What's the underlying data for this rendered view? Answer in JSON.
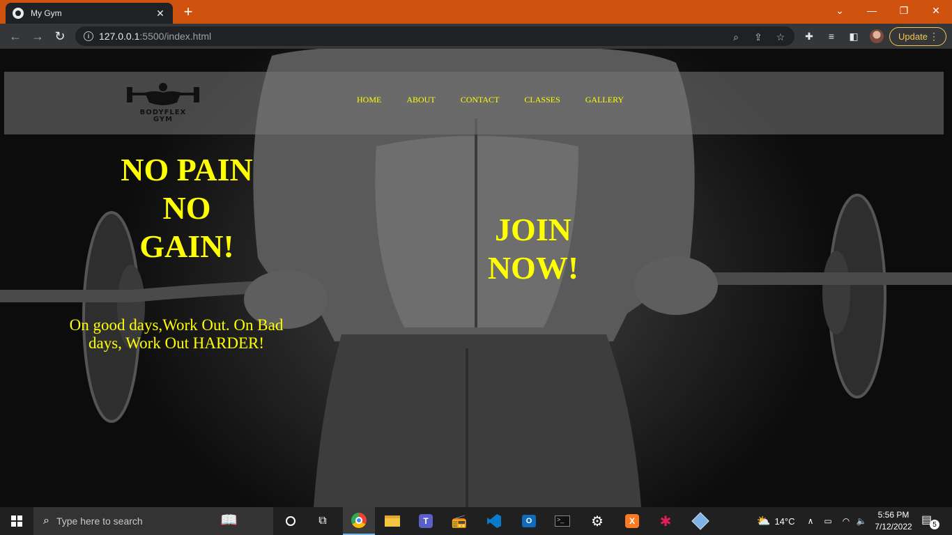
{
  "browser": {
    "tab_title": "My Gym",
    "url_host": "127.0.0.1",
    "url_rest": ":5500/index.html",
    "update_label": "Update"
  },
  "site": {
    "logo_line1": "BODYFLEX",
    "logo_line2": "GYM",
    "nav": [
      "HOME",
      "ABOUT",
      "CONTACT",
      "CLASSES",
      "GALLERY"
    ],
    "slogan": [
      "NO PAIN",
      "NO",
      "GAIN!"
    ],
    "join": [
      "JOIN",
      "NOW!"
    ],
    "tagline_line1": "On good days,Work Out. On Bad",
    "tagline_line2": "days, Work Out HARDER!",
    "accent_color": "#ffff00"
  },
  "taskbar": {
    "search_placeholder": "Type here to search",
    "weather": "14°C",
    "time": "5:56 PM",
    "date": "7/12/2022",
    "notification_count": "5"
  },
  "colors": {
    "titlebar": "#cf520f",
    "toolbar": "#35363a",
    "taskbar": "#202020"
  }
}
